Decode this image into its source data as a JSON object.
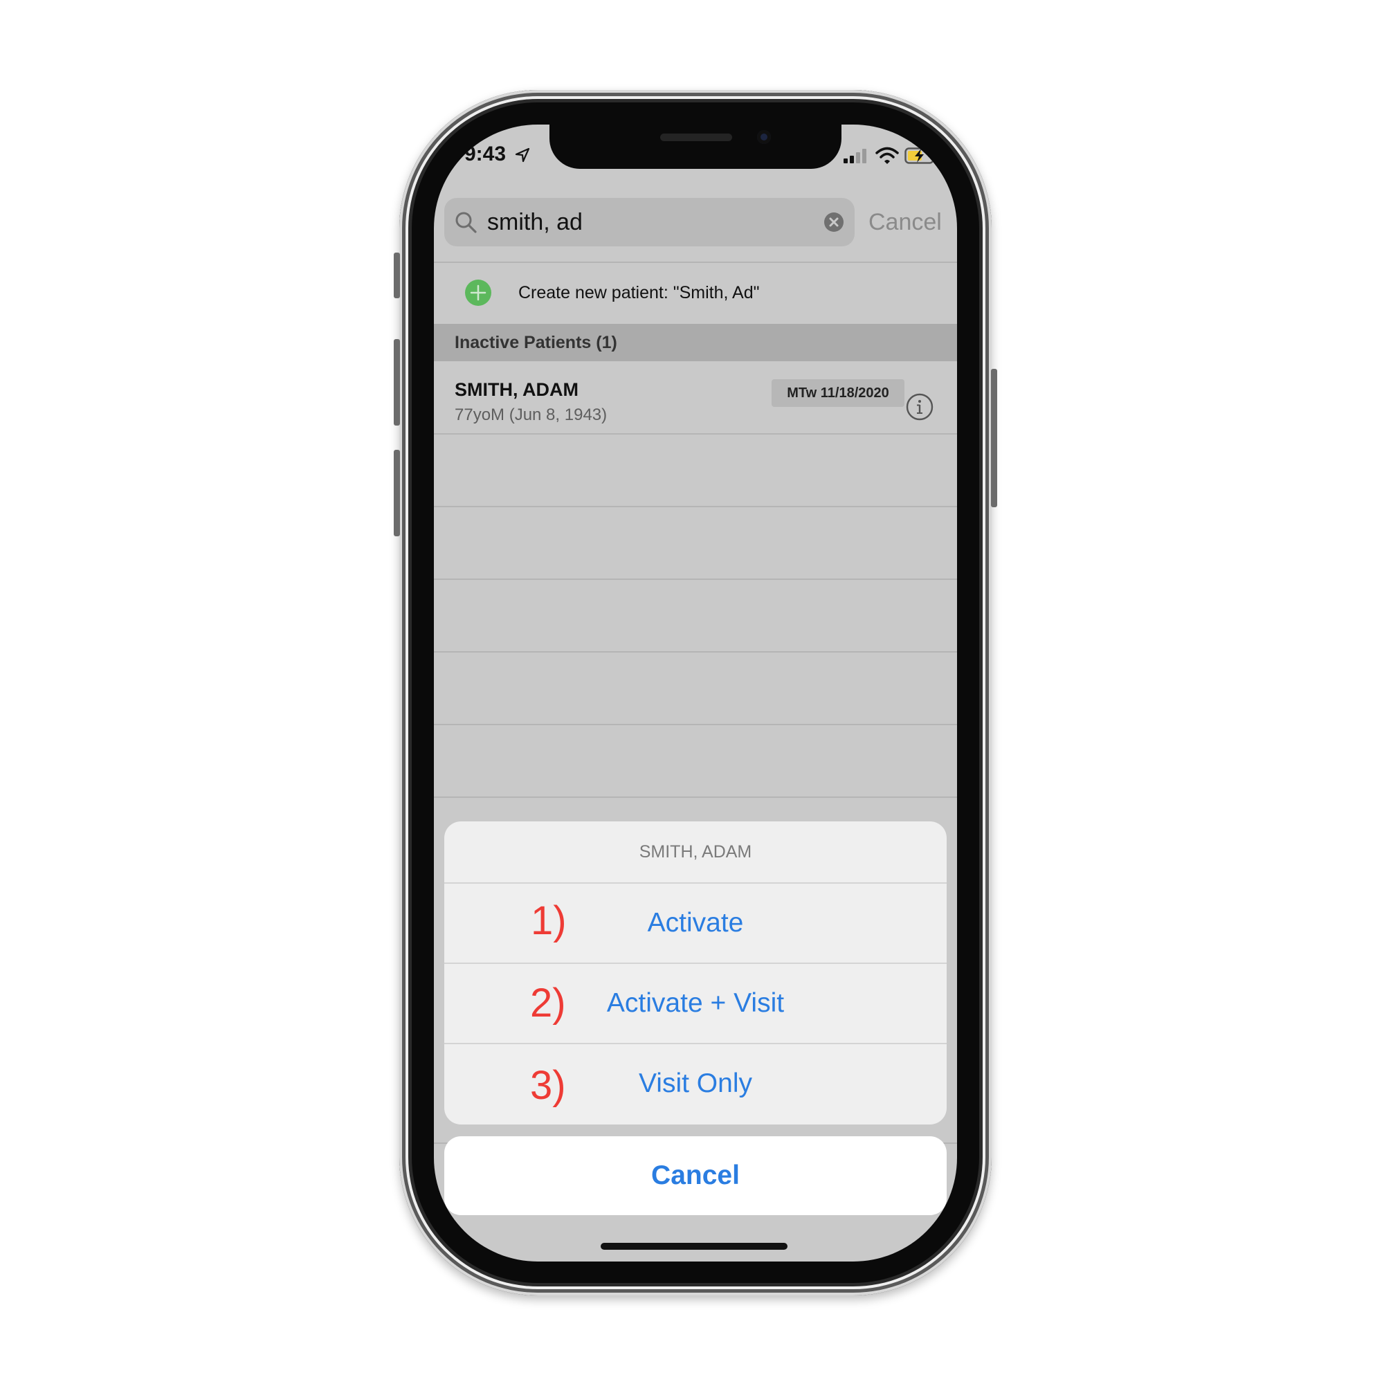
{
  "status_bar": {
    "time": "9:43",
    "icons": [
      "location-arrow-icon",
      "cellular-signal-icon",
      "wifi-icon",
      "battery-charging-icon"
    ]
  },
  "search": {
    "value": "smith, ad",
    "cancel_label": "Cancel",
    "icons": [
      "search-icon",
      "clear-search-icon"
    ]
  },
  "create_patient": {
    "label": "Create new patient: \"Smith, Ad\"",
    "icon": "add-icon",
    "icon_color": "#5cb85c"
  },
  "section": {
    "title": "Inactive Patients (1)"
  },
  "patients": [
    {
      "name": "SMITH, ADAM",
      "details": "77yoM (Jun 8, 1943)",
      "badge": "MTw 11/18/2020",
      "icon": "info-icon"
    }
  ],
  "action_sheet": {
    "title": "SMITH, ADAM",
    "actions": [
      {
        "step": "1)",
        "label": "Activate"
      },
      {
        "step": "2)",
        "label": "Activate + Visit"
      },
      {
        "step": "3)",
        "label": "Visit Only"
      }
    ],
    "cancel_label": "Cancel"
  },
  "colors": {
    "action_blue": "#2a7de1",
    "annotation_red": "#ee3b35",
    "dimmed_background": "#c9c9c9"
  }
}
